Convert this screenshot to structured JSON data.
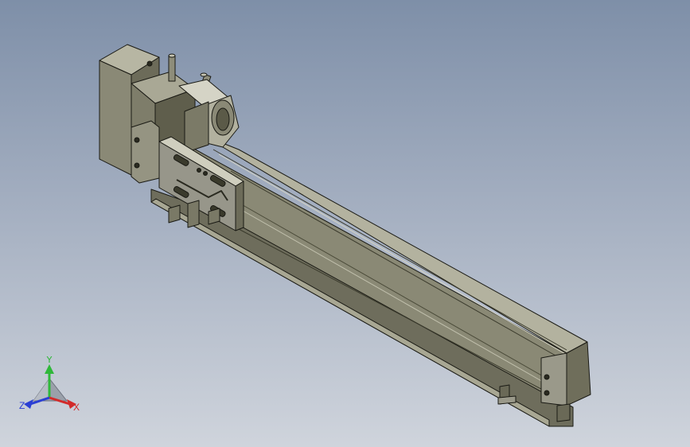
{
  "viewport": {
    "background_top": "#7e8fa8",
    "background_bottom": "#cfd4dc"
  },
  "model": {
    "body_color": "#8d8c79",
    "dark_color": "#55543f",
    "light_color": "#b9b8a6",
    "edge_color": "#1a1a14"
  },
  "triad": {
    "labels": {
      "x": "X",
      "y": "Y",
      "z": "Z"
    },
    "colors": {
      "x": "#d22a2a",
      "y": "#2fb83a",
      "z": "#2b3fd4"
    }
  }
}
